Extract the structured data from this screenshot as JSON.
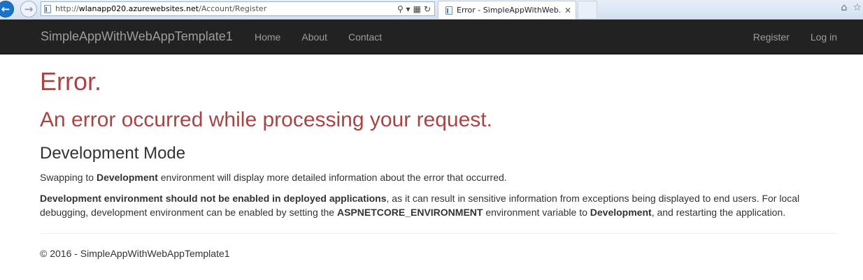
{
  "browser": {
    "url_prefix": "http://",
    "url_host": "wlanapp020.azurewebsites.net",
    "url_path": "/Account/Register",
    "search_glyph": "⚲ ▾",
    "tab_title": "Error - SimpleAppWithWeb...",
    "tab_close": "✕",
    "icons": [
      "back-arrow-icon",
      "forward-arrow-icon",
      "search-icon",
      "compatibility-icon",
      "refresh-icon",
      "home-icon",
      "favorites-star-icon"
    ]
  },
  "navbar": {
    "brand": "SimpleAppWithWebAppTemplate1",
    "links": [
      "Home",
      "About",
      "Contact"
    ],
    "register": "Register",
    "login": "Log in",
    "background": "#222222",
    "link_color": "#9d9d9d"
  },
  "content": {
    "title": "Error.",
    "subtitle": "An error occurred while processing your request.",
    "dev_heading": "Development Mode",
    "p1": {
      "pre": "Swapping to ",
      "bold": "Development",
      "post": " environment will display more detailed information about the error that occurred."
    },
    "p2": {
      "bold1": "Development environment should not be enabled in deployed applications",
      "text1": ", as it can result in sensitive information from exceptions being displayed to end users. For local debugging, development environment can be enabled by setting the ",
      "bold2": "ASPNETCORE_ENVIRONMENT",
      "text2": " environment variable to ",
      "bold3": "Development",
      "text3": ", and restarting the application."
    },
    "error_color": "#a94442"
  },
  "footer": {
    "text": "© 2016 - SimpleAppWithWebAppTemplate1"
  }
}
